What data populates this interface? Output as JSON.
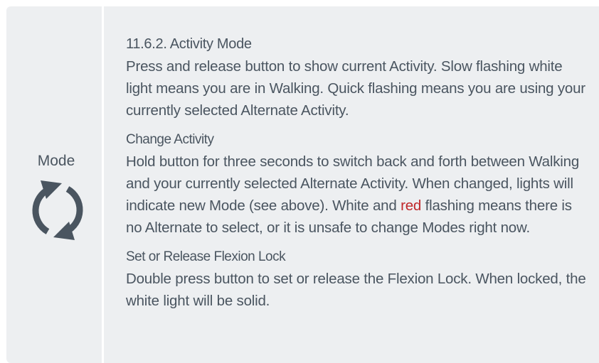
{
  "sidebar": {
    "label": "Mode",
    "icon": "refresh-cycle-icon",
    "icon_color": "#4a5560"
  },
  "colors": {
    "background": "#edeff1",
    "text": "#4a5560",
    "highlight": "#c0282b"
  },
  "sections": [
    {
      "heading": "11.6.2. Activity Mode",
      "body": "Press and release button to show current Activity. Slow flashing white light means you are in Walking. Quick flashing means you are using your currently selected Alternate Activity."
    },
    {
      "heading": "Change Activity",
      "body_before": "Hold button for three seconds to switch back and forth between Walking and your currently selected Alternate Activity. When changed, lights will indicate new Mode (see above). White and ",
      "body_highlight": "red",
      "body_after": " flashing means there is no Alternate to select, or it is unsafe to change Modes right now."
    },
    {
      "heading": "Set or Release Flexion Lock",
      "body": "Double press button to set or release the Flexion Lock. When locked, the white light will be solid."
    }
  ]
}
